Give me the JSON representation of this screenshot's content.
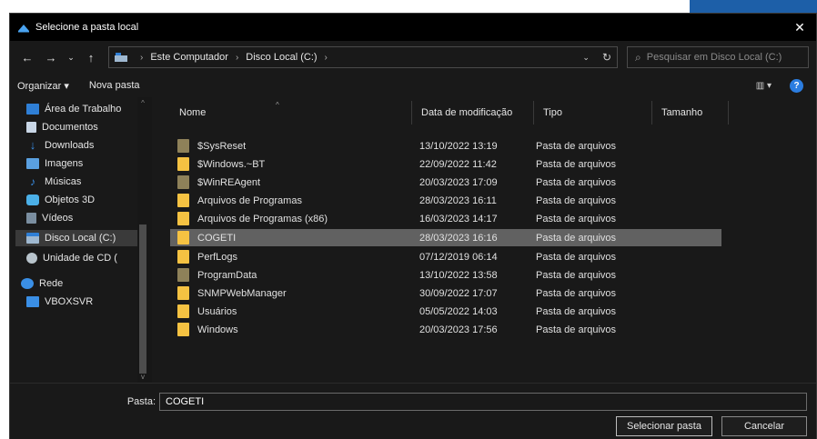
{
  "window": {
    "title": "Selecione a pasta local",
    "close_glyph": "✕"
  },
  "nav": {
    "back": "←",
    "forward": "→",
    "recent": "⌄",
    "up": "↑",
    "breadcrumbs": [
      "Este Computador",
      "Disco Local (C:)"
    ],
    "sep": "›",
    "dropdown": "⌄",
    "refresh": "↻",
    "search_placeholder": "Pesquisar em Disco Local (C:)"
  },
  "toolbar": {
    "organize": "Organizar ▾",
    "new_folder": "Nova pasta",
    "view": "▥ ▾",
    "help": "?"
  },
  "sidebar": {
    "items": [
      {
        "label": "Área de Trabalho",
        "icon": "desktop-icon",
        "color": "#2f7fd6"
      },
      {
        "label": "Documentos",
        "icon": "documents-icon",
        "color": "#c9d6e6"
      },
      {
        "label": "Downloads",
        "icon": "downloads-icon",
        "color": "#3a8fe6"
      },
      {
        "label": "Imagens",
        "icon": "images-icon",
        "color": "#5aa0e0"
      },
      {
        "label": "Músicas",
        "icon": "music-icon",
        "color": "#3a8fe6"
      },
      {
        "label": "Objetos 3D",
        "icon": "objects3d-icon",
        "color": "#4bb0e8"
      },
      {
        "label": "Vídeos",
        "icon": "videos-icon",
        "color": "#7a8ea0"
      },
      {
        "label": "Disco Local (C:)",
        "icon": "drive-icon",
        "color": "#9fb8d0"
      },
      {
        "label": "Unidade de CD (",
        "icon": "cd-drive-icon",
        "color": "#b8c4cc"
      },
      {
        "label": "Rede",
        "icon": "network-icon",
        "color": "#3a8fe6"
      },
      {
        "label": "VBOXSVR",
        "icon": "network-drive-icon",
        "color": "#3a8fe6"
      }
    ],
    "selected_index": 7
  },
  "columns": {
    "name": "Nome",
    "date": "Data de modificação",
    "type": "Tipo",
    "size": "Tamanho"
  },
  "files": [
    {
      "name": "$SysReset",
      "date": "13/10/2022 13:19",
      "type": "Pasta de arquivos",
      "color": "#8e8159"
    },
    {
      "name": "$Windows.~BT",
      "date": "22/09/2022 11:42",
      "type": "Pasta de arquivos",
      "color": "#f5c242"
    },
    {
      "name": "$WinREAgent",
      "date": "20/03/2023 17:09",
      "type": "Pasta de arquivos",
      "color": "#8e8159"
    },
    {
      "name": "Arquivos de Programas",
      "date": "28/03/2023 16:11",
      "type": "Pasta de arquivos",
      "color": "#f5c242"
    },
    {
      "name": "Arquivos de Programas (x86)",
      "date": "16/03/2023 14:17",
      "type": "Pasta de arquivos",
      "color": "#f5c242"
    },
    {
      "name": "COGETI",
      "date": "28/03/2023 16:16",
      "type": "Pasta de arquivos",
      "color": "#f5c242"
    },
    {
      "name": "PerfLogs",
      "date": "07/12/2019 06:14",
      "type": "Pasta de arquivos",
      "color": "#f5c242"
    },
    {
      "name": "ProgramData",
      "date": "13/10/2022 13:58",
      "type": "Pasta de arquivos",
      "color": "#8e8159"
    },
    {
      "name": "SNMPWebManager",
      "date": "30/09/2022 17:07",
      "type": "Pasta de arquivos",
      "color": "#f5c242"
    },
    {
      "name": "Usuários",
      "date": "05/05/2022 14:03",
      "type": "Pasta de arquivos",
      "color": "#f5c242"
    },
    {
      "name": "Windows",
      "date": "20/03/2023 17:56",
      "type": "Pasta de arquivos",
      "color": "#f5c242"
    }
  ],
  "selected_file_index": 5,
  "footer": {
    "folder_label": "Pasta:",
    "folder_value": "COGETI",
    "select_button": "Selecionar pasta",
    "cancel_button": "Cancelar"
  }
}
